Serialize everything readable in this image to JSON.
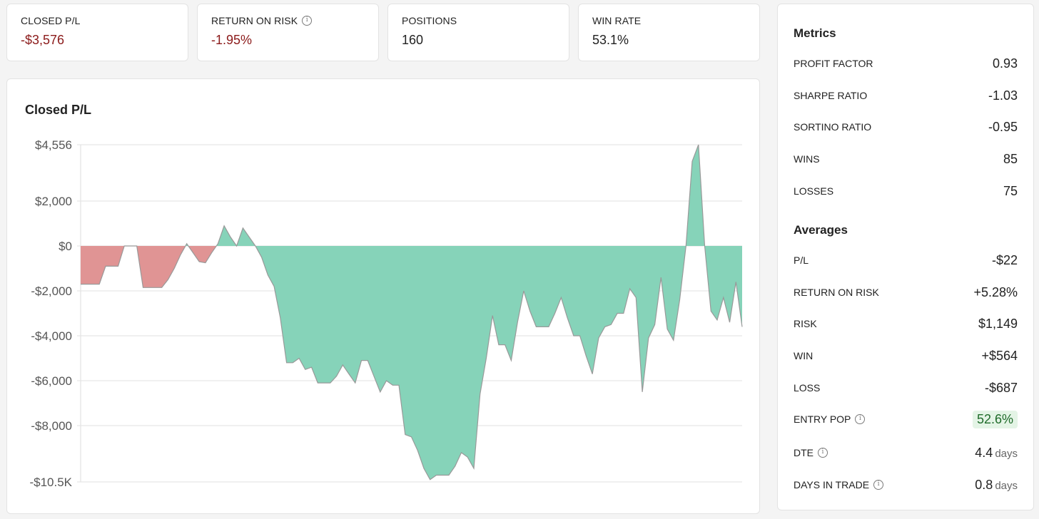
{
  "stats": [
    {
      "label": "CLOSED P/L",
      "value": "-$3,576",
      "tone": "neg",
      "info": false
    },
    {
      "label": "RETURN ON RISK",
      "value": "-1.95%",
      "tone": "neg",
      "info": true
    },
    {
      "label": "POSITIONS",
      "value": "160",
      "tone": "plain",
      "info": false
    },
    {
      "label": "WIN RATE",
      "value": "53.1%",
      "tone": "plain",
      "info": false
    }
  ],
  "chart": {
    "title": "Closed P/L",
    "y_ticks": [
      "$4,556",
      "$2,000",
      "$0",
      "-$2,000",
      "-$4,000",
      "-$6,000",
      "-$8,000",
      "-$10.5K"
    ]
  },
  "metrics": {
    "heading": "Metrics",
    "rows": [
      {
        "label": "PROFIT FACTOR",
        "value": "0.93"
      },
      {
        "label": "SHARPE RATIO",
        "value": "-1.03"
      },
      {
        "label": "SORTINO RATIO",
        "value": "-0.95"
      },
      {
        "label": "WINS",
        "value": "85"
      },
      {
        "label": "LOSSES",
        "value": "75"
      }
    ]
  },
  "averages": {
    "heading": "Averages",
    "rows": [
      {
        "label": "P/L",
        "value": "-$22",
        "tone": "neg"
      },
      {
        "label": "RETURN ON RISK",
        "value": "+5.28%",
        "tone": "pos"
      },
      {
        "label": "RISK",
        "value": "$1,149",
        "tone": "plain"
      },
      {
        "label": "WIN",
        "value": "+$564",
        "tone": "pos"
      },
      {
        "label": "LOSS",
        "value": "-$687",
        "tone": "neg"
      }
    ],
    "entry_pop": {
      "label": "ENTRY POP",
      "value": "52.6%"
    },
    "dte": {
      "label": "DTE",
      "value": "4.4",
      "unit": "days"
    },
    "days_in_trade": {
      "label": "DAYS IN TRADE",
      "value": "0.8",
      "unit": "days"
    }
  },
  "colors": {
    "negative_fill": "#e09494",
    "positive_fill": "#86d3b9",
    "line": "#999999",
    "negative_text": "#8b1a1a",
    "positive_text": "#1f6b2a"
  },
  "chart_data": {
    "type": "area",
    "title": "Closed P/L",
    "xlabel": "",
    "ylabel": "",
    "ylim": [
      -10500,
      4556
    ],
    "y_ticks": [
      4556,
      2000,
      0,
      -2000,
      -4000,
      -6000,
      -8000,
      -10500
    ],
    "grid": true,
    "values": [
      -1700,
      -1700,
      -1700,
      -1700,
      -900,
      -900,
      -900,
      0,
      0,
      0,
      -1850,
      -1850,
      -1850,
      -1850,
      -1500,
      -1000,
      -400,
      100,
      -300,
      -700,
      -750,
      -300,
      100,
      900,
      400,
      0,
      800,
      400,
      0,
      -500,
      -1300,
      -1800,
      -3200,
      -5200,
      -5200,
      -5000,
      -5500,
      -5400,
      -6100,
      -6100,
      -6100,
      -5800,
      -5300,
      -5700,
      -6100,
      -5100,
      -5100,
      -5800,
      -6500,
      -6000,
      -6200,
      -6200,
      -8400,
      -8500,
      -9100,
      -9900,
      -10400,
      -10200,
      -10200,
      -10200,
      -9800,
      -9200,
      -9400,
      -9900,
      -6600,
      -5000,
      -3100,
      -4400,
      -4400,
      -5100,
      -3400,
      -2000,
      -2900,
      -3600,
      -3600,
      -3600,
      -3000,
      -2300,
      -3200,
      -4000,
      -4000,
      -4900,
      -5700,
      -4100,
      -3600,
      -3500,
      -3000,
      -3000,
      -1900,
      -2300,
      -6500,
      -4100,
      -3500,
      -1400,
      -3700,
      -4200,
      -2400,
      0,
      3800,
      4556,
      0,
      -2900,
      -3300,
      -2300,
      -3400,
      -1600,
      -3600
    ]
  }
}
